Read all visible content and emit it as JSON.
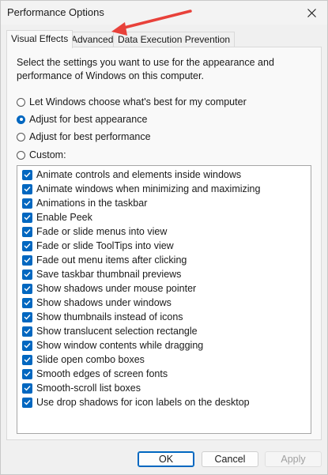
{
  "window": {
    "title": "Performance Options",
    "close_glyph": "✕"
  },
  "tabs": [
    {
      "label": "Visual Effects",
      "active": true
    },
    {
      "label": "Advanced",
      "active": false
    },
    {
      "label": "Data Execution Prevention",
      "active": false
    }
  ],
  "panel": {
    "description": "Select the settings you want to use for the appearance and performance of Windows on this computer.",
    "options": [
      {
        "label": "Let Windows choose what's best for my computer",
        "checked": false
      },
      {
        "label": "Adjust for best appearance",
        "checked": true
      },
      {
        "label": "Adjust for best performance",
        "checked": false
      },
      {
        "label": "Custom:",
        "checked": false
      }
    ],
    "effects": [
      {
        "label": "Animate controls and elements inside windows",
        "checked": true
      },
      {
        "label": "Animate windows when minimizing and maximizing",
        "checked": true
      },
      {
        "label": "Animations in the taskbar",
        "checked": true
      },
      {
        "label": "Enable Peek",
        "checked": true
      },
      {
        "label": "Fade or slide menus into view",
        "checked": true
      },
      {
        "label": "Fade or slide ToolTips into view",
        "checked": true
      },
      {
        "label": "Fade out menu items after clicking",
        "checked": true
      },
      {
        "label": "Save taskbar thumbnail previews",
        "checked": true
      },
      {
        "label": "Show shadows under mouse pointer",
        "checked": true
      },
      {
        "label": "Show shadows under windows",
        "checked": true
      },
      {
        "label": "Show thumbnails instead of icons",
        "checked": true
      },
      {
        "label": "Show translucent selection rectangle",
        "checked": true
      },
      {
        "label": "Show window contents while dragging",
        "checked": true
      },
      {
        "label": "Slide open combo boxes",
        "checked": true
      },
      {
        "label": "Smooth edges of screen fonts",
        "checked": true
      },
      {
        "label": "Smooth-scroll list boxes",
        "checked": true
      },
      {
        "label": "Use drop shadows for icon labels on the desktop",
        "checked": true
      }
    ]
  },
  "buttons": {
    "ok": "OK",
    "cancel": "Cancel",
    "apply": "Apply"
  },
  "colors": {
    "accent": "#0067c0",
    "annotation_arrow": "#e8413a"
  }
}
